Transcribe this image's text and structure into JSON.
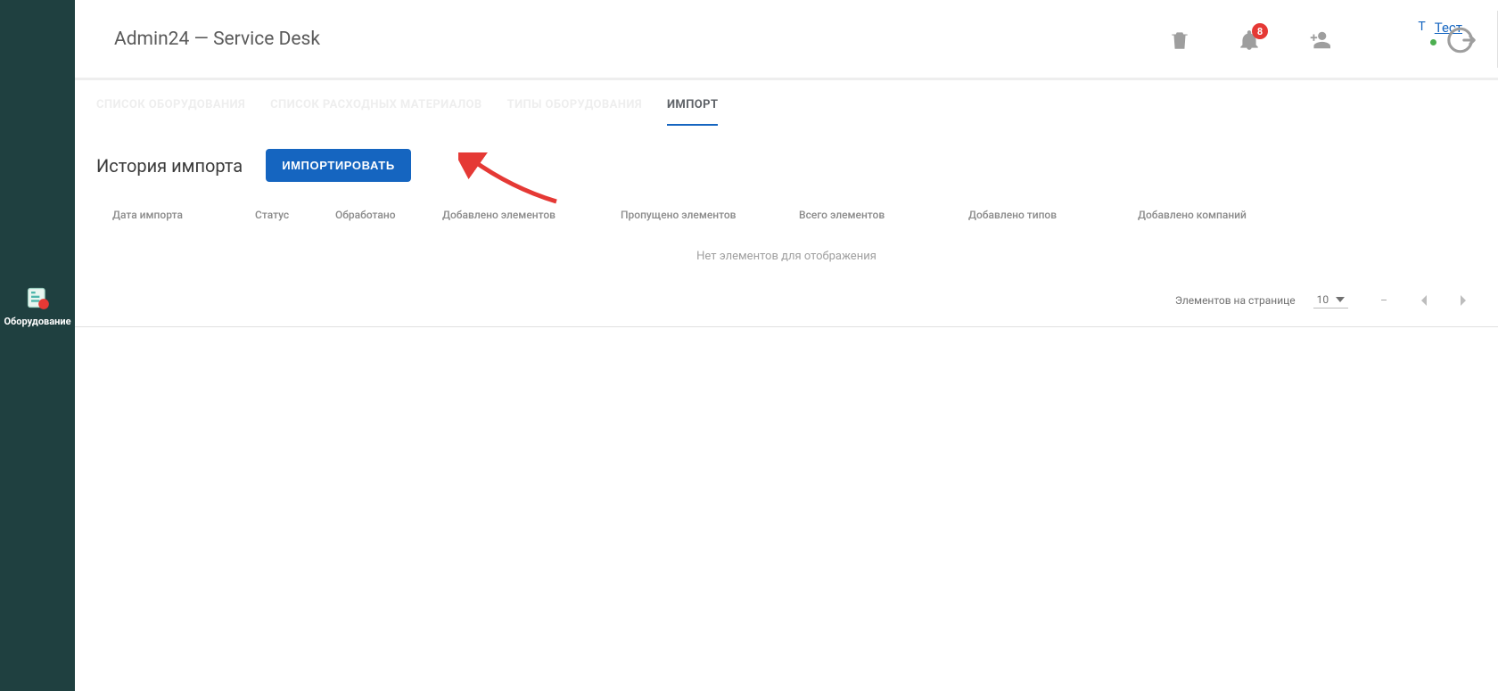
{
  "sidebar": {
    "items": [
      {
        "label": "Оборудование",
        "icon": "equipment-icon"
      }
    ]
  },
  "header": {
    "app_title": "Admin24 — Service Desk",
    "notifications_count": "8",
    "user": {
      "initial": "Т",
      "name": "Тест"
    }
  },
  "tabs": [
    {
      "label": "СПИСОК ОБОРУДОВАНИЯ",
      "active": false
    },
    {
      "label": "СПИСОК РАСХОДНЫХ МАТЕРИАЛОВ",
      "active": false
    },
    {
      "label": "ТИПЫ ОБОРУДОВАНИЯ",
      "active": false
    },
    {
      "label": "ИМПОРТ",
      "active": true
    }
  ],
  "section": {
    "title": "История импорта",
    "import_button": "ИМПОРТИРОВАТЬ"
  },
  "table": {
    "columns": [
      "Дата импорта",
      "Статус",
      "Обработано",
      "Добавлено элементов",
      "Пропущено элементов",
      "Всего элементов",
      "Добавлено типов",
      "Добавлено компаний"
    ],
    "empty_text": "Нет элементов для отображения"
  },
  "pagination": {
    "label": "Элементов на странице",
    "size": "10",
    "range": "–"
  }
}
